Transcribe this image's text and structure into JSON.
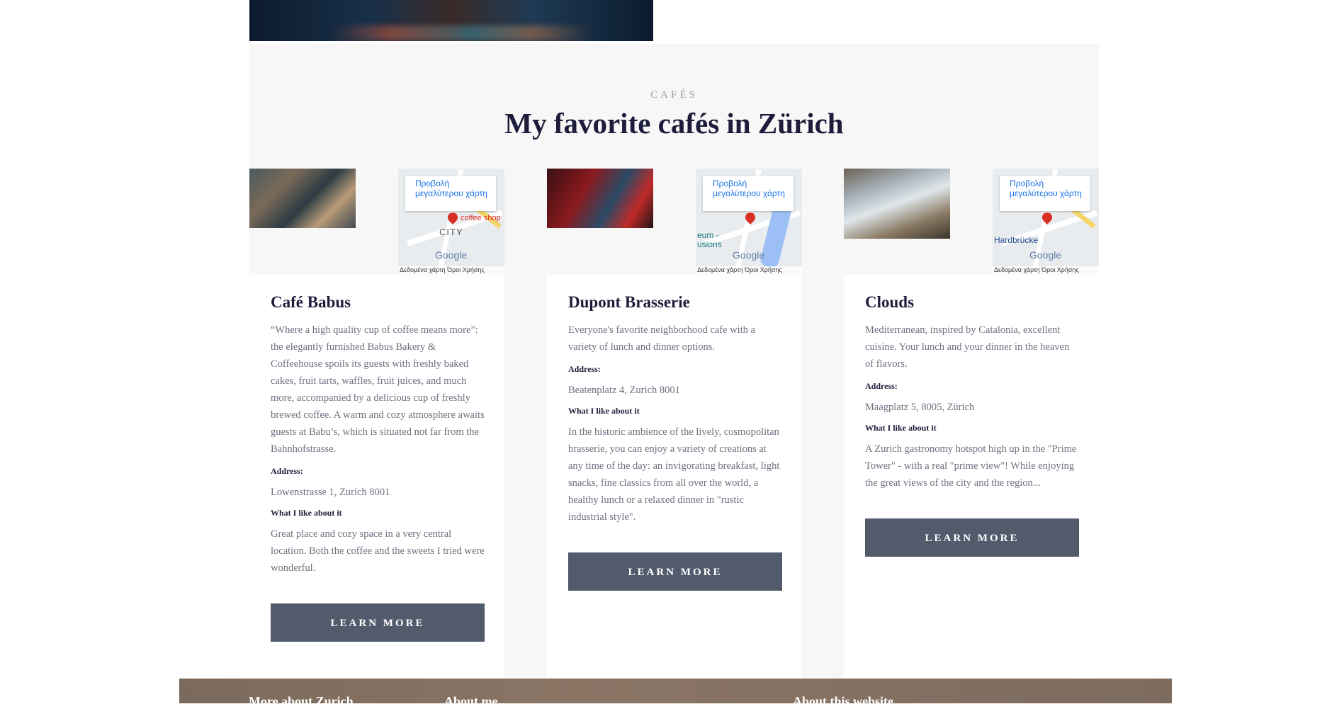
{
  "section": {
    "eyebrow": "CAFÉS",
    "title": "My favorite cafés in Zürich"
  },
  "map_labels": {
    "view_larger": "Προβολή μεγαλύτερου χάρτη",
    "terms": "Δεδομένα χάρτη   Όροι Χρήσης",
    "brand": "Google",
    "card1_pin": "coffee shop",
    "card1_area": "CITY",
    "card2_area": "eum - usions",
    "card3_area": "Hardbrücke"
  },
  "labels": {
    "address": "Address:",
    "what_i_like": "What I like about it",
    "learn_more": "LEARN MORE"
  },
  "cards": [
    {
      "title": "Café Babus",
      "description": "“Where a high quality cup of coffee means more”: the elegantly furnished Babus Bakery & Coffeehouse spoils its guests with freshly baked cakes, fruit tarts, waffles, fruit juices, and much more, accompanied by a delicious cup of freshly brewed coffee. A warm and cozy atmosphere awaits guests at Babu’s, which is situated not far from the Bahnhofstrasse.",
      "address": "Lowenstrasse 1, Zurich 8001",
      "like": "Great place and cozy space in a very central location. Both the coffee and the sweets I tried were wonderful."
    },
    {
      "title": "Dupont Brasserie",
      "description": "Everyone's favorite neighborhood cafe with a variety of lunch and dinner options.",
      "address": "Beatenplatz 4, Zurich 8001",
      "like": "In the historic ambience of the lively, cosmopolitan brasserie, you can enjoy a variety of creations at any time of the day: an invigorating breakfast, light snacks, fine classics from all over the world, a healthy lunch or a relaxed dinner in \"rustic industrial style\"."
    },
    {
      "title": "Clouds",
      "description": "Mediterranean, inspired by Catalonia, excellent cuisine. Your lunch and your dinner in the heaven of flavors.",
      "address": "Maagplatz 5, 8005, Zürich",
      "like": "A Zurich gastronomy hotspot high up in the \"Prime Tower\" - with a real \"prime view\"! While enjoying the great views of the city and the region..."
    }
  ],
  "footer": {
    "col1": "More about Zurich",
    "col2": "About me",
    "col3": "About this website"
  }
}
